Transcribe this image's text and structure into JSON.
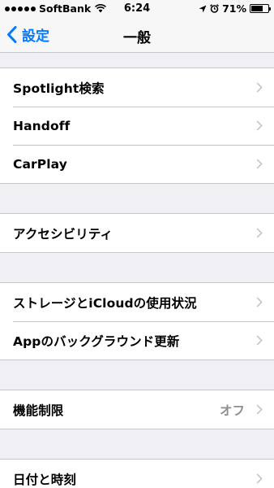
{
  "status_bar": {
    "carrier": "SoftBank",
    "time": "6:24",
    "battery_percent": "71%",
    "battery_level": 0.71
  },
  "nav": {
    "back_label": "設定",
    "title": "一般"
  },
  "groups": [
    {
      "items": [
        {
          "label": "Spotlight検索"
        },
        {
          "label": "Handoff"
        },
        {
          "label": "CarPlay"
        }
      ]
    },
    {
      "items": [
        {
          "label": "アクセシビリティ"
        }
      ]
    },
    {
      "items": [
        {
          "label": "ストレージとiCloudの使用状況"
        },
        {
          "label": "Appのバックグラウンド更新"
        }
      ]
    },
    {
      "items": [
        {
          "label": "機能制限",
          "value": "オフ"
        }
      ]
    },
    {
      "items": [
        {
          "label": "日付と時刻"
        }
      ]
    }
  ],
  "colors": {
    "accent": "#007aff",
    "background": "#efeff4",
    "separator": "#c8c7cc",
    "secondary_text": "#8e8e93"
  }
}
